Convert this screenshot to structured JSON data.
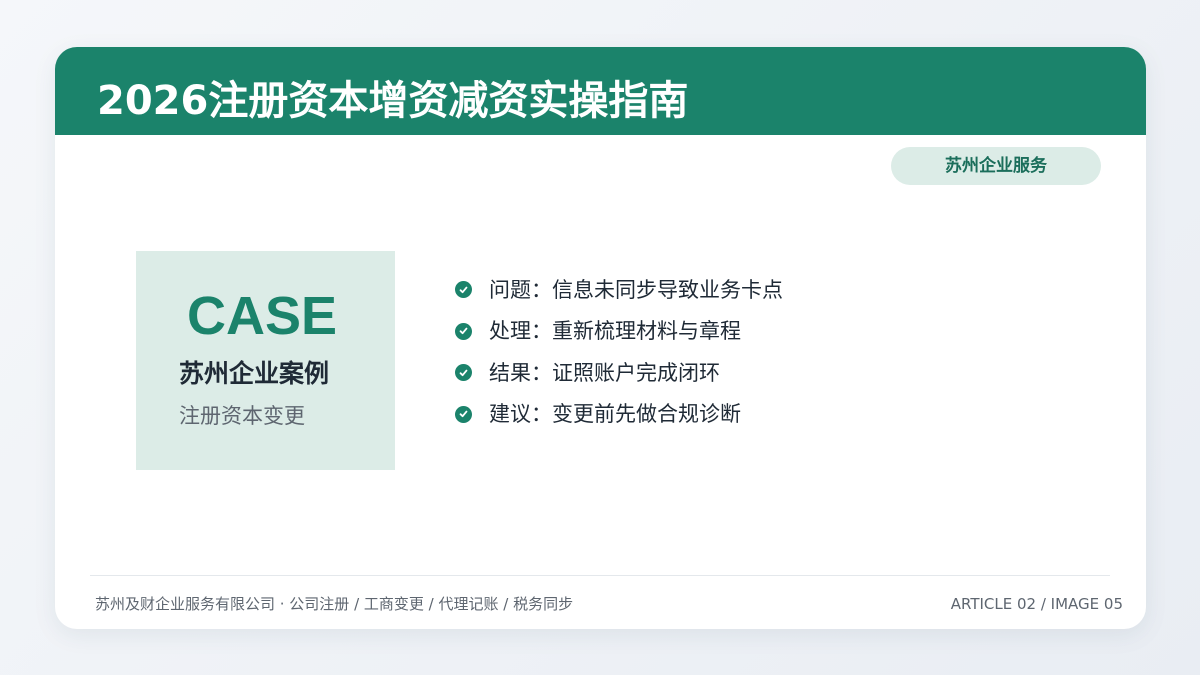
{
  "header": {
    "title": "2026注册资本增资减资实操指南"
  },
  "badge": {
    "label": "苏州企业服务"
  },
  "case_box": {
    "word": "CASE",
    "name": "苏州企业案例",
    "subtitle": "注册资本变更"
  },
  "points": [
    {
      "icon": "check-circle-icon",
      "text": "问题：信息未同步导致业务卡点"
    },
    {
      "icon": "check-circle-icon",
      "text": "处理：重新梳理材料与章程"
    },
    {
      "icon": "check-circle-icon",
      "text": "结果：证照账户完成闭环"
    },
    {
      "icon": "check-circle-icon",
      "text": "建议：变更前先做合规诊断"
    }
  ],
  "footer": {
    "left": "苏州及财企业服务有限公司 · 公司注册 / 工商变更 / 代理记账 / 税务同步",
    "right": "ARTICLE 02 / IMAGE 05"
  },
  "colors": {
    "brand_green": "#1b836b",
    "soft_green": "#dcece7",
    "text_dark": "#1f2a36",
    "text_muted": "#5e6670"
  }
}
